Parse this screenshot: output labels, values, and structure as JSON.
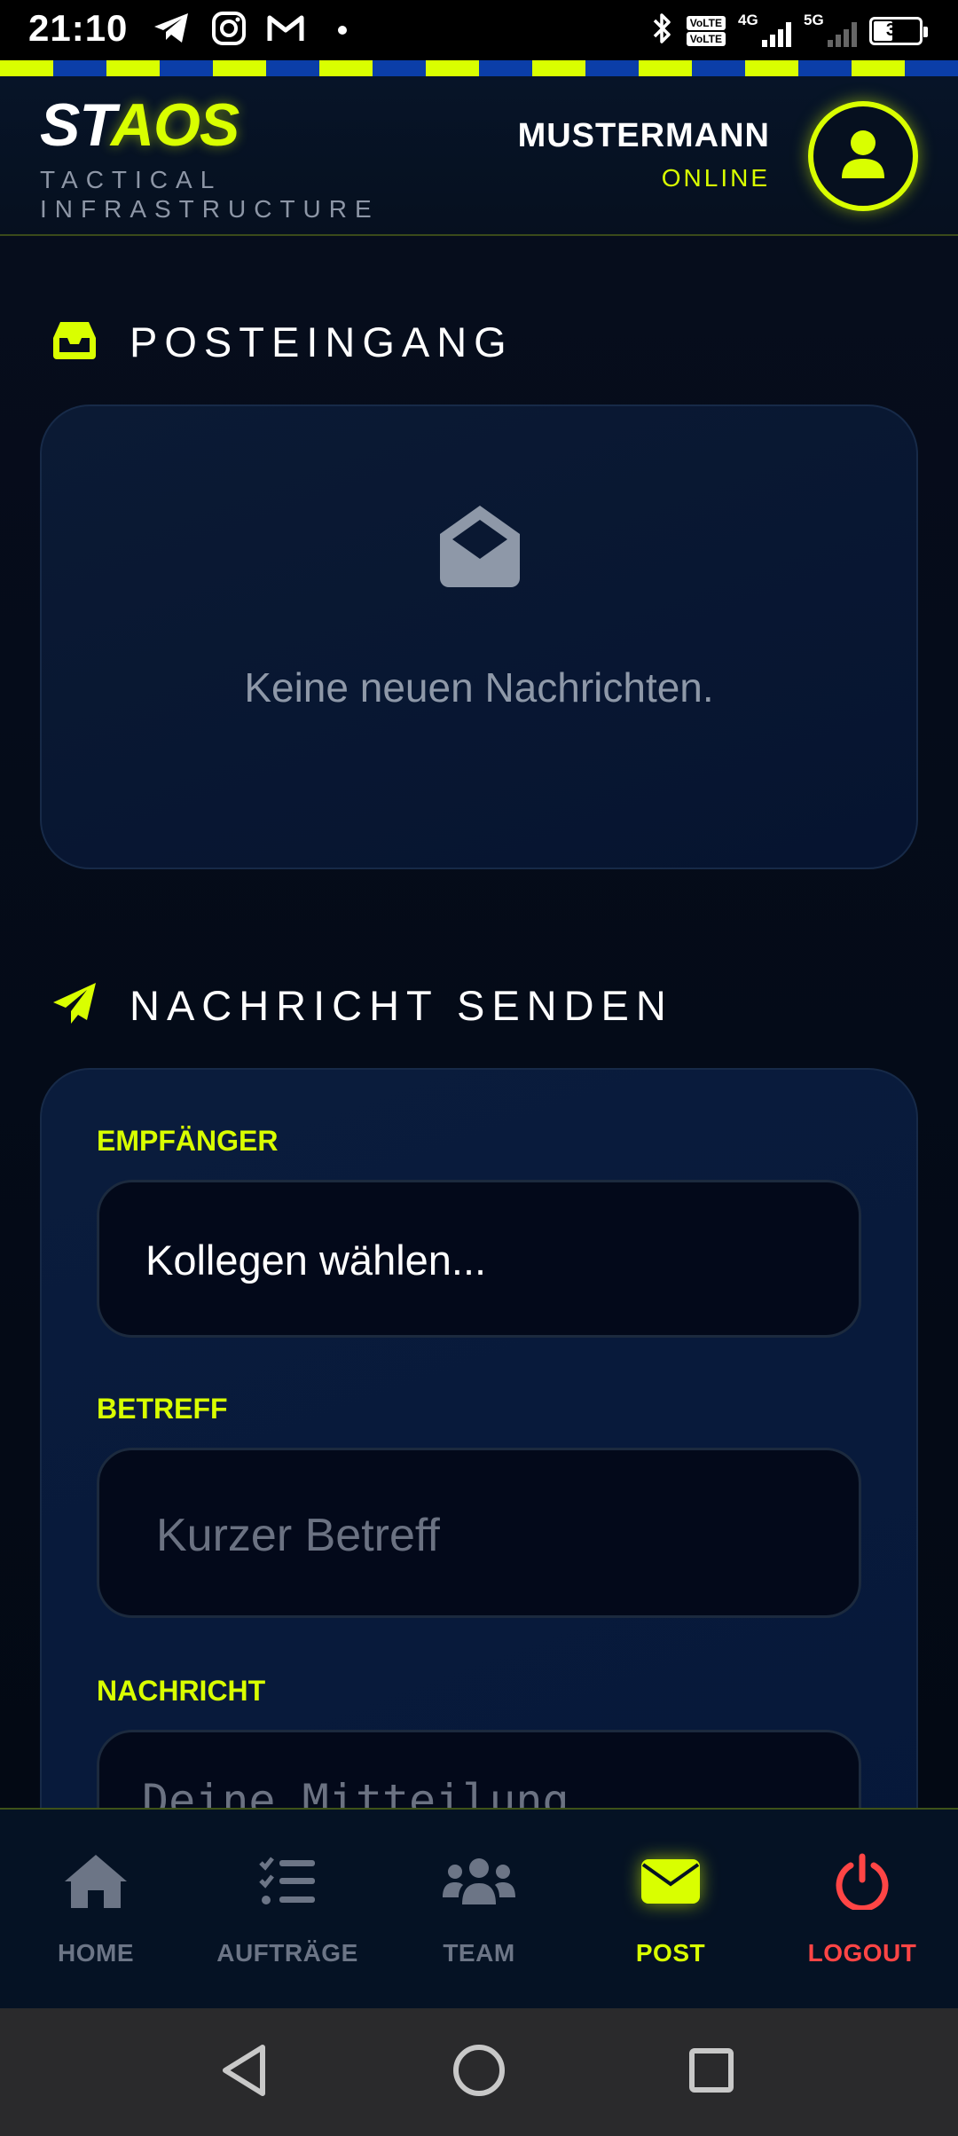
{
  "status_bar": {
    "time": "21:10",
    "battery": "36",
    "volte_1": "VoLTE",
    "volte_2": "VoLTE",
    "net_1": "4G",
    "net_2": "5G"
  },
  "header": {
    "brand_part1": "ST",
    "brand_part2": "AOS",
    "subtitle_line1": "TACTICAL",
    "subtitle_line2": "INFRASTRUCTURE",
    "user_name": "MUSTERMANN",
    "user_status": "ONLINE"
  },
  "inbox": {
    "title": "POSTEINGANG",
    "empty_text": "Keine neuen Nachrichten."
  },
  "compose": {
    "title": "NACHRICHT SENDEN",
    "recipient_label": "EMPFÄNGER",
    "recipient_value": "Kollegen wählen...",
    "subject_label": "BETREFF",
    "subject_placeholder": "Kurzer Betreff",
    "message_label": "NACHRICHT",
    "message_placeholder": "Deine Mitteilung..."
  },
  "nav": {
    "home": "HOME",
    "tasks": "AUFTRÄGE",
    "team": "TEAM",
    "post": "POST",
    "logout": "LOGOUT",
    "active": "post"
  },
  "colors": {
    "accent": "#d9ff00",
    "background": "#040b18",
    "logout": "#ff4545",
    "muted": "#8e98a8"
  },
  "icons": {
    "inbox_section": "inbox-tray-icon",
    "compose_section": "paper-plane-icon",
    "empty_inbox": "envelope-open-icon",
    "avatar": "user-icon",
    "home": "house-icon",
    "tasks": "checklist-icon",
    "team": "users-icon",
    "post": "envelope-icon",
    "logout": "power-icon"
  }
}
